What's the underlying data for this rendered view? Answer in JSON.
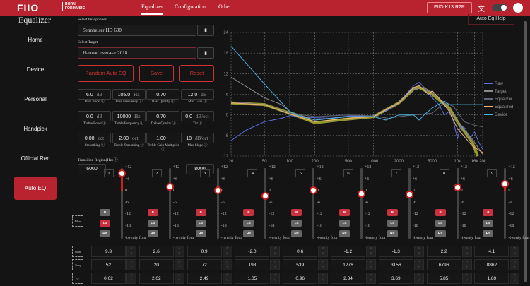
{
  "header": {
    "logo": "FIIO",
    "tagline_1": "BORN",
    "tagline_2": "FOR MUSIC",
    "tabs": [
      "Equalizer",
      "Configuration",
      "Other"
    ],
    "device": "FIIO K13 R2R"
  },
  "sidebar": {
    "title": "Equalizer",
    "items": [
      "Home",
      "Device",
      "Personal",
      "Handpick",
      "Official Rec",
      "Auto EQ"
    ]
  },
  "form": {
    "headphones_label": "Select headphones",
    "headphones": "Sennheiser HD 600",
    "target_label": "Select Target",
    "target": "Harman over-ear 2018",
    "buttons": {
      "random": "Random Auto EQ",
      "save": "Save",
      "reset": "Reset"
    },
    "params": [
      {
        "value": "6.0",
        "unit": "dB",
        "label": "Bass Boost"
      },
      {
        "value": "105.0",
        "unit": "Hz",
        "label": "Bass Frequency"
      },
      {
        "value": "0.70",
        "unit": "",
        "label": "Bass Quality"
      },
      {
        "value": "12.0",
        "unit": "dB",
        "label": "Max Gain"
      },
      {
        "value": "0.0",
        "unit": "dB",
        "label": "Treble Boost"
      },
      {
        "value": "10000",
        "unit": "Hz",
        "label": "Treble Frequency"
      },
      {
        "value": "0.70",
        "unit": "",
        "label": "Treble Quality"
      },
      {
        "value": "0.0",
        "unit": "dB/oct",
        "label": "Tilt"
      },
      {
        "value": "0.08",
        "unit": "oct",
        "label": "Smoothing"
      },
      {
        "value": "2.00",
        "unit": "oct",
        "label": "Treble Smoothing"
      },
      {
        "value": "1.00",
        "unit": "",
        "label": "Treble Gain Multiplier"
      },
      {
        "value": "18",
        "unit": "dB/oct",
        "label": "Max Slope"
      }
    ],
    "transition_label": "Transition Region(Hz)",
    "transition_low": "6000",
    "transition_high": "8000"
  },
  "help_button": "Auto Eq Help",
  "chart_data": {
    "type": "line",
    "xscale": "log",
    "xlim": [
      20,
      20000
    ],
    "ylim": [
      -12,
      24
    ],
    "xticks": [
      "20",
      "50",
      "100",
      "200",
      "500",
      "1000",
      "2000",
      "5000",
      "10k",
      "16k",
      "20k"
    ],
    "xtick_values": [
      20,
      50,
      100,
      200,
      500,
      1000,
      2000,
      5000,
      10000,
      16000,
      20000
    ],
    "yticks": [
      24,
      18,
      12,
      6,
      0,
      -6,
      -12
    ],
    "series": [
      {
        "name": "Raw",
        "color": "#5b72e0",
        "width": 1,
        "points": [
          [
            20,
            -7.5
          ],
          [
            30,
            -4.5
          ],
          [
            50,
            -2
          ],
          [
            80,
            -1
          ],
          [
            100,
            -0.2
          ],
          [
            200,
            -0.8
          ],
          [
            300,
            -1
          ],
          [
            500,
            -0.3
          ],
          [
            1000,
            -0.3
          ],
          [
            1500,
            1.5
          ],
          [
            2000,
            3.5
          ],
          [
            3000,
            8.5
          ],
          [
            3500,
            9.5
          ],
          [
            4000,
            8
          ],
          [
            5000,
            5
          ],
          [
            6000,
            3
          ],
          [
            7000,
            0
          ],
          [
            8000,
            1
          ],
          [
            9000,
            -2
          ],
          [
            10000,
            -7
          ],
          [
            11000,
            -3
          ],
          [
            12500,
            -4
          ],
          [
            14000,
            -7
          ],
          [
            16000,
            -5
          ],
          [
            18000,
            -8
          ],
          [
            20000,
            -10
          ]
        ]
      },
      {
        "name": "Target",
        "color": "#8a8a8a",
        "width": 1,
        "points": [
          [
            20,
            11
          ],
          [
            50,
            5
          ],
          [
            80,
            3
          ],
          [
            100,
            1
          ],
          [
            200,
            -1.5
          ],
          [
            500,
            -0.5
          ],
          [
            1000,
            -0.5
          ],
          [
            2000,
            3.5
          ],
          [
            3000,
            7.5
          ],
          [
            4000,
            8
          ],
          [
            5000,
            6.5
          ],
          [
            7000,
            3.5
          ],
          [
            10000,
            -2
          ],
          [
            15000,
            -7
          ],
          [
            20000,
            -11.5
          ]
        ]
      },
      {
        "name": "Equalizer",
        "color": "#5e6678",
        "width": 1,
        "points": [
          [
            20,
            3.8
          ],
          [
            50,
            3
          ],
          [
            100,
            0.5
          ],
          [
            200,
            -0.5
          ],
          [
            500,
            0
          ],
          [
            1000,
            -0.3
          ],
          [
            1500,
            -1
          ],
          [
            2000,
            -0.5
          ],
          [
            3000,
            0
          ],
          [
            5000,
            0.5
          ],
          [
            7000,
            3.5
          ],
          [
            9000,
            2.5
          ],
          [
            12000,
            -2
          ],
          [
            16000,
            -3
          ],
          [
            20000,
            -3.5
          ]
        ]
      },
      {
        "name": "Equalized",
        "color": "#f2b57a",
        "width": 1,
        "points": [
          [
            20,
            3.5
          ],
          [
            50,
            3
          ],
          [
            100,
            0.3
          ],
          [
            200,
            -2
          ],
          [
            500,
            -1
          ],
          [
            1000,
            -0.5
          ],
          [
            2000,
            3.5
          ],
          [
            3000,
            8
          ],
          [
            3500,
            8.5
          ],
          [
            4500,
            6
          ],
          [
            5000,
            7
          ],
          [
            6000,
            5
          ],
          [
            8000,
            1
          ],
          [
            10000,
            -4
          ],
          [
            15000,
            -9
          ],
          [
            20000,
            -11
          ]
        ]
      },
      {
        "name": "Target band",
        "color": "#a9b035",
        "width": 4,
        "legend": false,
        "points": [
          [
            20,
            3.5
          ],
          [
            50,
            3
          ],
          [
            100,
            0.5
          ],
          [
            200,
            -2.3
          ],
          [
            500,
            -1.2
          ],
          [
            1000,
            -0.5
          ],
          [
            2000,
            3.5
          ],
          [
            3000,
            7.5
          ],
          [
            3500,
            8
          ],
          [
            5000,
            6
          ],
          [
            8000,
            2
          ],
          [
            10000,
            -2
          ],
          [
            15000,
            -8
          ],
          [
            17500,
            -12
          ]
        ]
      },
      {
        "name": "Device",
        "color": "#4fb3e0",
        "width": 1,
        "points": [
          [
            20,
            20
          ],
          [
            50,
            9
          ],
          [
            100,
            1
          ],
          [
            120,
            0
          ],
          [
            200,
            -1.5
          ],
          [
            500,
            -0.5
          ],
          [
            1000,
            -0.5
          ],
          [
            1400,
            -1.5
          ],
          [
            2000,
            0
          ],
          [
            3000,
            0
          ],
          [
            3500,
            -1.5
          ],
          [
            4000,
            0
          ],
          [
            5000,
            2
          ],
          [
            7000,
            4
          ],
          [
            8000,
            3
          ],
          [
            20000,
            3
          ]
        ]
      }
    ]
  },
  "bands": {
    "scale": [
      "+12",
      "+6",
      "0",
      "-6",
      "-12",
      "-18",
      "-twenty four"
    ],
    "filter_label": "Filter",
    "filter_types": [
      "P",
      "LS",
      "HS"
    ],
    "row_labels": [
      "Gain",
      "Freq",
      "Q"
    ],
    "items": [
      {
        "num": "1",
        "type": "LS",
        "gain": "9.3",
        "freq": "52",
        "q": "0.62"
      },
      {
        "num": "2",
        "type": "P",
        "gain": "2.6",
        "freq": "20",
        "q": "2.02"
      },
      {
        "num": "3",
        "type": "P",
        "gain": "0.9",
        "freq": "72",
        "q": "2.49"
      },
      {
        "num": "4",
        "type": "P",
        "gain": "-2.0",
        "freq": "198",
        "q": "1.05"
      },
      {
        "num": "5",
        "type": "P",
        "gain": "0.6",
        "freq": "539",
        "q": "0.96"
      },
      {
        "num": "6",
        "type": "P",
        "gain": "-1.2",
        "freq": "1276",
        "q": "2.34"
      },
      {
        "num": "7",
        "type": "P",
        "gain": "-1.3",
        "freq": "3156",
        "q": "3.69"
      },
      {
        "num": "8",
        "type": "P",
        "gain": "2.2",
        "freq": "6796",
        "q": "5.85"
      },
      {
        "num": "9",
        "type": "P",
        "gain": "4.1",
        "freq": "8862",
        "q": "1.89"
      }
    ]
  }
}
